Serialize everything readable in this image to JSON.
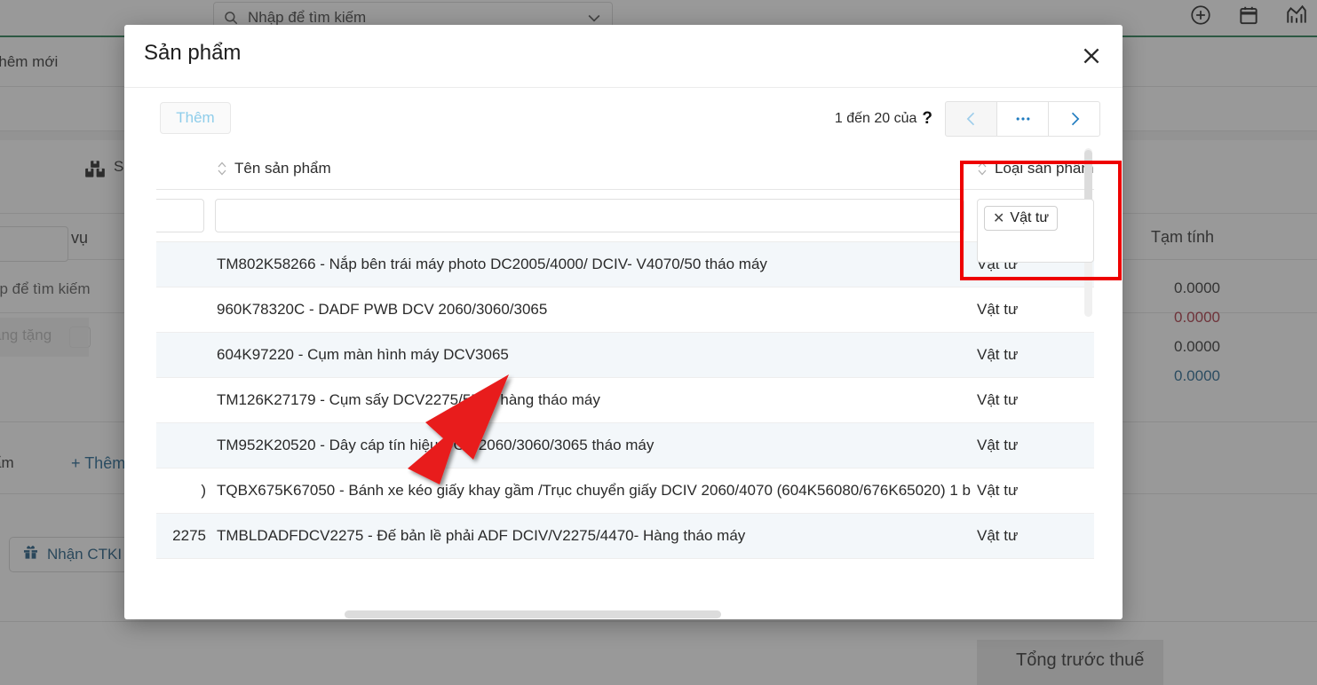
{
  "background": {
    "search": {
      "placeholder": "Nhập để tìm kiếm",
      "icon": "search-icon",
      "chevron": "chevron-down-icon"
    },
    "top_icons": [
      "plus-circle-icon",
      "calendar-icon",
      "chart-icon"
    ],
    "add_new_label": "Thêm mới",
    "section_label": "Sả",
    "section_icon": "boxes-icon",
    "product_service_label": "phẩm/dịch vụ",
    "search_hint": "ập để tìm kiếm",
    "gift_label": "àng tặng",
    "add_product_partial": "ẩm",
    "add_link_label": "+ Thêm",
    "ctkm_button_label": "Nhận CTKI",
    "ctkm_icon": "gift-icon",
    "subtotal_header": "Tạm tính",
    "subtotal_values": [
      "0.0000",
      "0.0000",
      "0.0000",
      "0.0000"
    ],
    "subtotal_colors": [
      "#2b2b2b",
      "#a62b3a",
      "#2b2b2b",
      "#1a5f8a"
    ],
    "total_before_tax_label": "Tổng trước thuế"
  },
  "modal": {
    "title": "Sản phẩm",
    "close_icon": "close-icon",
    "toolbar": {
      "add_label": "Thêm",
      "pager_text": "1 đến 20 của",
      "pager_unknown": "?",
      "prev_icon": "chevron-left-icon",
      "more_icon": "ellipsis-icon",
      "next_icon": "chevron-right-icon"
    },
    "table": {
      "columns": [
        {
          "key": "name",
          "label": "Tên sản phẩm",
          "sort_icon": "sort-updown-icon"
        },
        {
          "key": "type",
          "label": "Loại sản phẩm",
          "sort_icon": "sort-updown-icon"
        }
      ],
      "filters": {
        "name_value": "",
        "type_chip": "Vật tư",
        "chip_remove_icon": "close-small-icon"
      },
      "rows": [
        {
          "pre": "",
          "name": "TM802K58266 - Nắp bên trái máy photo DC2005/4000/ DCIV- V4070/50 tháo máy",
          "type": "Vật tư"
        },
        {
          "pre": "",
          "name": "960K78320C - DADF PWB DCV 2060/3060/3065",
          "type": "Vật tư"
        },
        {
          "pre": "",
          "name": "604K97220 - Cụm màn hình máy DCV3065",
          "type": "Vật tư"
        },
        {
          "pre": "",
          "name": "TM126K27179 - Cụm sấy DCV2275/5576 hàng tháo máy",
          "type": "Vật tư"
        },
        {
          "pre": "",
          "name": "TM952K20520 - Dây cáp tín hiệu DCV 2060/3060/3065 tháo máy",
          "type": "Vật tư"
        },
        {
          "pre": ")",
          "name": "TQBX675K67050 - Bánh xe kéo giấy khay gầm /Trục chuyển giấy DCIV 2060/4070 (604K56080/676K65020) 1 b",
          "type": "Vật tư"
        },
        {
          "pre": "2275",
          "name": "TMBLDADFDCV2275 - Đế bản lề phải ADF DCIV/V2275/4470- Hàng tháo máy",
          "type": "Vật tư"
        }
      ]
    }
  },
  "annotations": {
    "highlight_box_color": "#ee0000",
    "arrow_color": "#e81c1c",
    "arrow_target": "TM952K20520 - Dây cáp tín hiệu DCV 2060/3060/3065 tháo máy"
  }
}
